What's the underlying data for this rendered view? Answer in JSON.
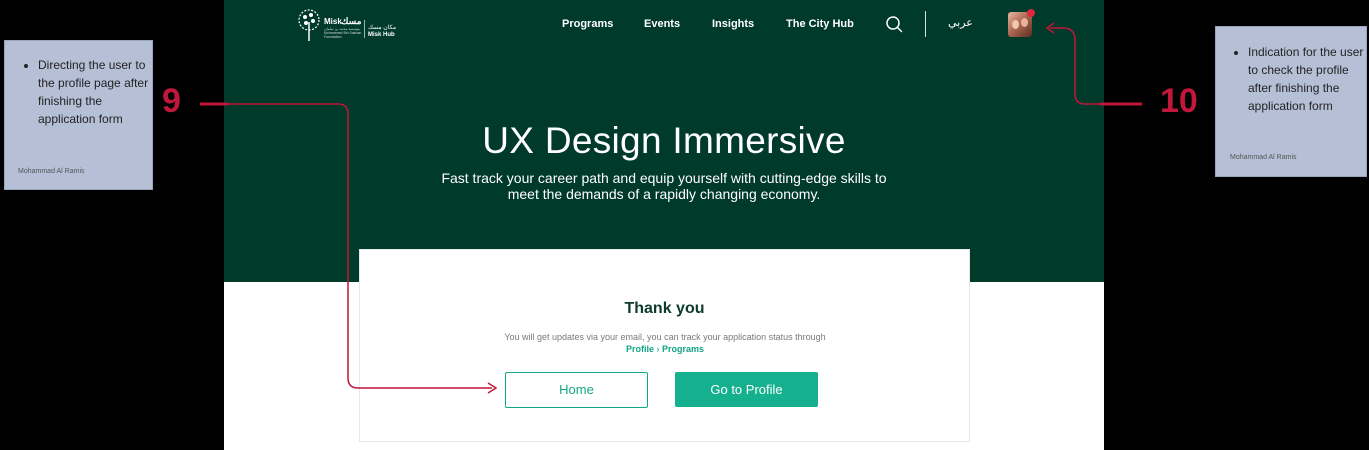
{
  "nav": {
    "links": [
      "Programs",
      "Events",
      "Insights",
      "The City Hub"
    ],
    "language": "عربي"
  },
  "logo": {
    "name_en": "Misk",
    "name_ar": "مسك",
    "subtitle": "مؤسسة محمد بن سلمان Mohammed Bin Salman Foundation",
    "hub_ar": "مكان مسك",
    "hub_en": "Misk Hub"
  },
  "hero": {
    "title": "UX Design Immersive",
    "subtitle": "Fast track your career path and equip yourself with cutting-edge skills to meet the demands of a rapidly changing economy."
  },
  "card": {
    "title": "Thank you",
    "message": "You will get updates via your email, you can track your application status through",
    "breadcrumb": [
      "Profile",
      "Programs"
    ],
    "home_label": "Home",
    "profile_label": "Go to Profile"
  },
  "annotations": [
    {
      "number": "9",
      "text": "Directing the user to the profile page after finishing the application form",
      "author": "Mohammad Al Ramis"
    },
    {
      "number": "10",
      "text": "Indication for the user to check the profile after finishing the application form",
      "author": "Mohammad Al Ramis"
    }
  ],
  "colors": {
    "hero_bg": "#003a2b",
    "accent": "#15b08e",
    "annotation_bg": "#b5c0d7",
    "annotation_marker": "#c0173a",
    "notification_dot": "#e0263f"
  }
}
